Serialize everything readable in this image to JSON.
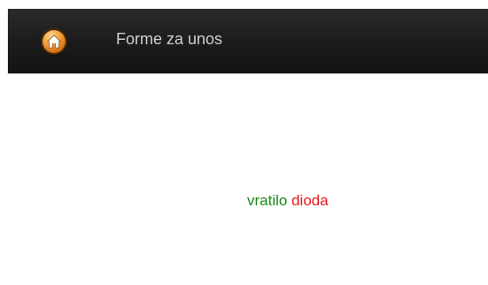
{
  "navbar": {
    "title": "Forme za unos",
    "home_icon": "home-icon"
  },
  "content": {
    "result_first": "vratilo",
    "result_second": "dioda"
  },
  "colors": {
    "navbar_bg": "#1c1c1c",
    "title_text": "#cfcfcf",
    "home_icon_orange": "#f5a13a",
    "result_first": "#1a8a1a",
    "result_second": "#e41b1b"
  }
}
